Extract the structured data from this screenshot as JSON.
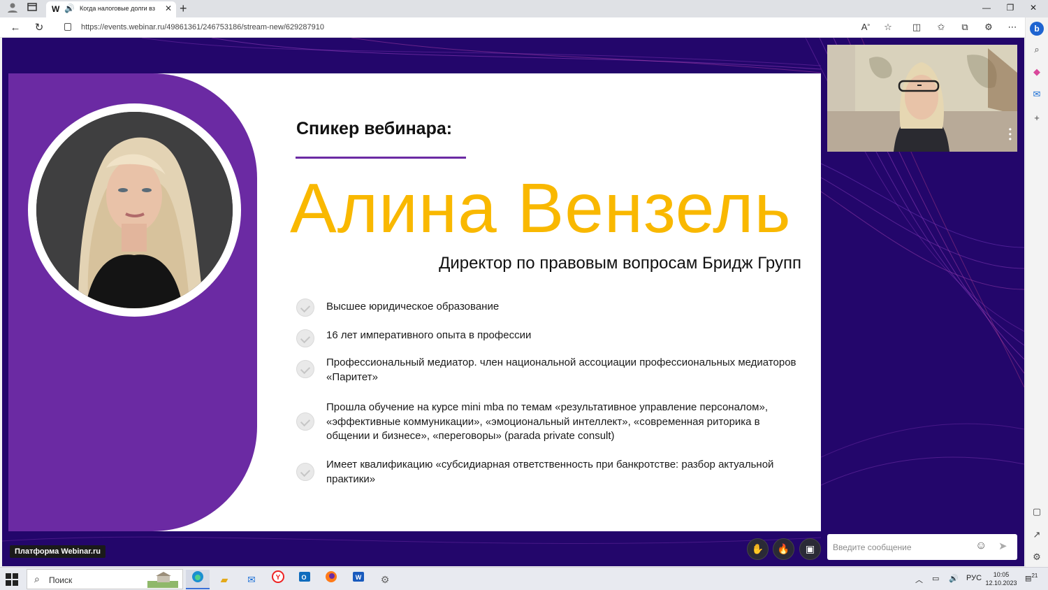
{
  "browser": {
    "tab_favicon": "W",
    "tab_title": "Когда налоговые долги вз",
    "url": "https://events.webinar.ru/49861361/246753186/stream-new/629287910"
  },
  "slide": {
    "speaker_label": "Спикер вебинара:",
    "name": "Алина Вензель",
    "role": "Директор по правовым вопросам Бридж Групп",
    "bullets": [
      "Высшее юридическое образование",
      "16 лет императивного опыта в профессии",
      "Профессиональный медиатор. член национальной ассоциации профессиональных медиаторов «Паритет»",
      "Прошла обучение на курсе mini mba по темам «результативное управление персоналом», «эффективные коммуникации», «эмоциональный интеллект», «современная риторика в общении и бизнесе», «переговоры» (parada private consult)",
      "Имеет квалификацию «субсидиарная ответственность при банкротстве: разбор актуальной практики»"
    ]
  },
  "chat": {
    "placeholder": "Введите сообщение"
  },
  "platform_badge": "Платформа Webinar.ru",
  "taskbar": {
    "search_label": "Поиск",
    "language": "РУС",
    "time": "10:05",
    "date": "12.10.2023",
    "notifications": "21"
  },
  "colors": {
    "stage_bg": "#23066b",
    "purple": "#6b2aa3",
    "name_yellow": "#f9b800"
  }
}
